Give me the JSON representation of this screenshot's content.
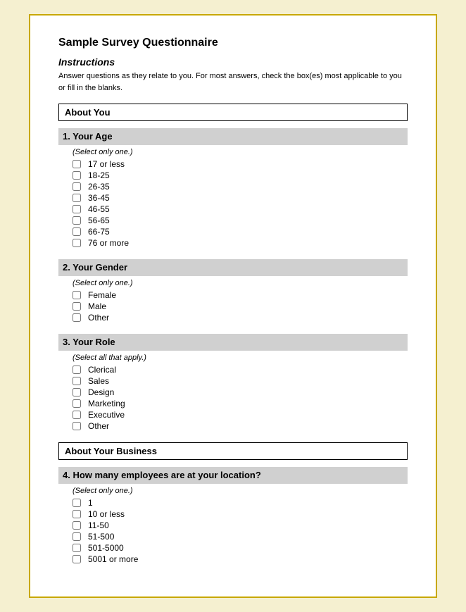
{
  "page": {
    "title": "Sample Survey Questionnaire",
    "instructions_heading": "Instructions",
    "instructions_text": "Answer questions as they relate to you. For most answers, check the box(es) most applicable to you or fill in the blanks."
  },
  "sections": [
    {
      "id": "about-you",
      "title": "About You",
      "questions": [
        {
          "id": "q1",
          "number": "1.",
          "title": "Your Age",
          "select_instruction": "(Select only one.)",
          "options": [
            "17 or less",
            "18-25",
            "26-35",
            "36-45",
            "46-55",
            "56-65",
            "66-75",
            "76 or more"
          ]
        },
        {
          "id": "q2",
          "number": "2.",
          "title": "Your Gender",
          "select_instruction": "(Select only one.)",
          "options": [
            "Female",
            "Male",
            "Other"
          ]
        },
        {
          "id": "q3",
          "number": "3.",
          "title": "Your Role",
          "select_instruction": "(Select all that apply.)",
          "options": [
            "Clerical",
            "Sales",
            "Design",
            "Marketing",
            "Executive",
            "Other"
          ]
        }
      ]
    },
    {
      "id": "about-business",
      "title": "About Your Business",
      "questions": [
        {
          "id": "q4",
          "number": "4.",
          "title": "How many employees are at your location?",
          "select_instruction": "(Select only one.)",
          "options": [
            "1",
            "10 or less",
            "11-50",
            "51-500",
            "501-5000",
            "5001 or more"
          ]
        }
      ]
    }
  ]
}
